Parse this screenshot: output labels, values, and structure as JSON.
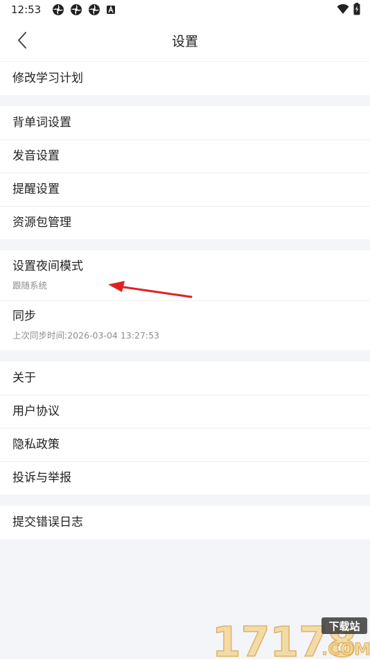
{
  "status_bar": {
    "time": "12:53",
    "notification_icons": [
      "pinwheel-icon",
      "pinwheel-icon",
      "pinwheel-icon",
      "a-badge-icon"
    ],
    "right_icons": [
      "wifi-icon",
      "battery-icon"
    ]
  },
  "header": {
    "title": "设置",
    "back_icon": "chevron-left-icon"
  },
  "groups": [
    {
      "items": [
        {
          "label": "修改学习计划"
        }
      ]
    },
    {
      "items": [
        {
          "label": "背单词设置"
        },
        {
          "label": "发音设置"
        },
        {
          "label": "提醒设置"
        },
        {
          "label": "资源包管理"
        }
      ]
    },
    {
      "items": [
        {
          "label": "设置夜间模式",
          "sub": "跟随系统"
        },
        {
          "label": "同步",
          "sub": "上次同步时间:2026-03-04 13:27:53"
        }
      ]
    },
    {
      "items": [
        {
          "label": "关于"
        },
        {
          "label": "用户协议"
        },
        {
          "label": "隐私政策"
        },
        {
          "label": "投诉与举报"
        }
      ]
    },
    {
      "items": [
        {
          "label": "提交错误日志"
        }
      ]
    }
  ],
  "annotation": {
    "arrow_color": "#e02020"
  },
  "watermark": {
    "text": "17178",
    "badge": "下载站",
    "domain": ".COM"
  },
  "colors": {
    "background": "#f3f5f8",
    "card": "#ffffff",
    "text": "#222222",
    "subtext": "#8c8c8c"
  }
}
